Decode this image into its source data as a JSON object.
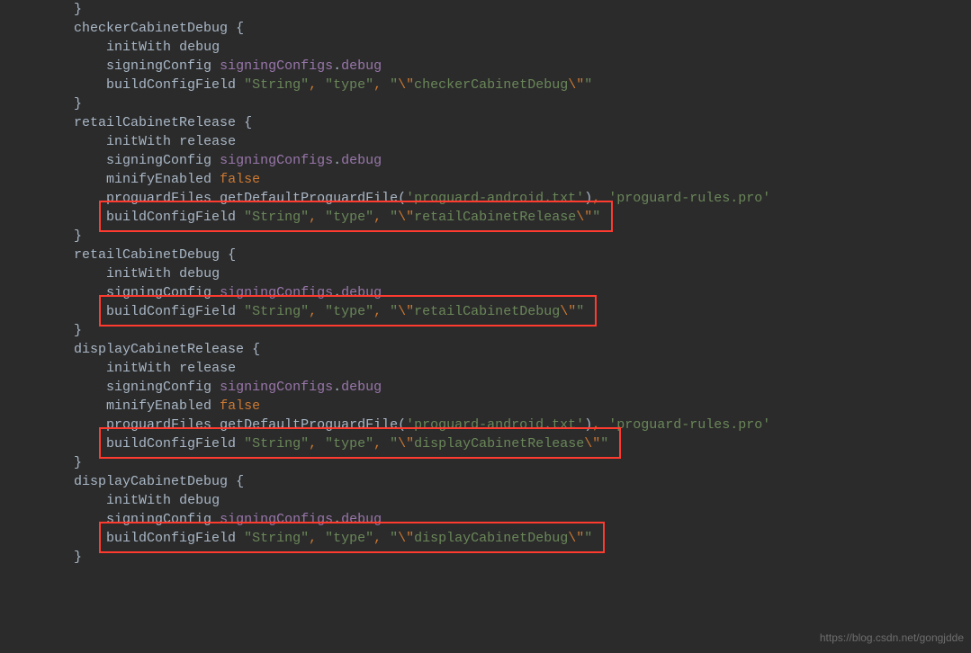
{
  "watermark": "https://blog.csdn.net/gongjdde",
  "blocks": [
    {
      "name": "checkerCabinetDebug",
      "type": "debug",
      "configVal": "checkerCabinetDebug",
      "release": false,
      "highlight": false,
      "header": false
    },
    {
      "name": "retailCabinetRelease",
      "type": "release",
      "configVal": "retailCabinetRelease",
      "release": true,
      "highlight": true,
      "header": true
    },
    {
      "name": "retailCabinetDebug",
      "type": "debug",
      "configVal": "retailCabinetDebug",
      "release": false,
      "highlight": true,
      "header": true
    },
    {
      "name": "displayCabinetRelease",
      "type": "release",
      "configVal": "displayCabinetRelease",
      "release": true,
      "highlight": true,
      "header": true
    },
    {
      "name": "displayCabinetDebug",
      "type": "debug",
      "configVal": "displayCabinetDebug",
      "release": false,
      "highlight": true,
      "header": true
    }
  ],
  "tokens": {
    "closeBrace": "}",
    "openBrace": "{",
    "initWith": "initWith",
    "debug": "debug",
    "release": "release",
    "signingConfig": "signingConfig",
    "signingConfigs": "signingConfigs",
    "dot": ".",
    "buildConfigField": "buildConfigField",
    "stringLit": "\"String\"",
    "typeLit": "\"type\"",
    "minifyEnabled": "minifyEnabled",
    "false": "false",
    "proguardFiles": "proguardFiles",
    "getDefaultProguardFile": "getDefaultProguardFile",
    "proguardAndroid": "'proguard-android.txt'",
    "proguardRules": "'proguard-rules.pro'",
    "escOpen": "\"\\\"",
    "escClose": "\\\"\""
  },
  "indent": {
    "lvl2": "        ",
    "lvl3": "            "
  }
}
